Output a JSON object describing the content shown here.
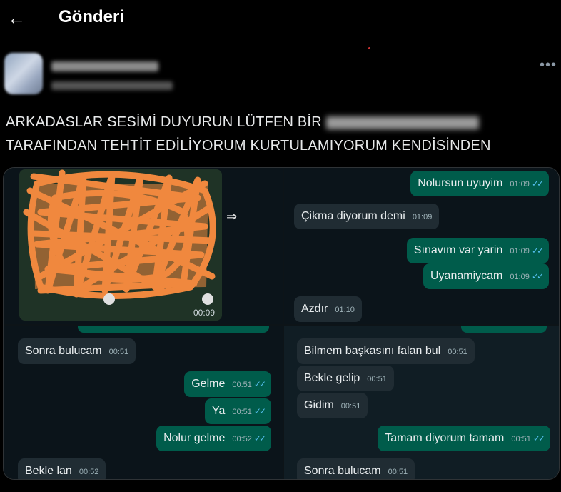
{
  "header": {
    "back_icon": "arrow-left-icon",
    "title": "Gönderi"
  },
  "post": {
    "more_icon": "more-dots-icon",
    "line1": "ARKADASLAR SESİMİ DUYURUN LÜTFEN BİR",
    "line2": "TARAFINDAN TEHTİT EDİLİYORUM KURTULAMIYORUM KENDİSİNDEN"
  },
  "panels": {
    "video": {
      "duration": "00:09",
      "forward_icon": "forward-icon"
    },
    "top_right": [
      {
        "text": "Nolursun uyuyim",
        "time": "01:09",
        "dir": "out"
      },
      {
        "text": "Çikma diyorum demi",
        "time": "01:09",
        "dir": "in"
      },
      {
        "text": "Sınavım var yarin",
        "time": "01:09",
        "dir": "out"
      },
      {
        "text": "Uyanamiycam",
        "time": "01:09",
        "dir": "out"
      },
      {
        "text": "Azdır",
        "time": "01:10",
        "dir": "in"
      }
    ],
    "bottom_left": [
      {
        "text": "Sonra bulucam",
        "time": "00:51",
        "dir": "in"
      },
      {
        "text": "Gelme",
        "time": "00:51",
        "dir": "out"
      },
      {
        "text": "Ya",
        "time": "00:51",
        "dir": "out"
      },
      {
        "text": "Nolur gelme",
        "time": "00:52",
        "dir": "out"
      },
      {
        "text": "Bekle lan",
        "time": "00:52",
        "dir": "in"
      }
    ],
    "bottom_right": [
      {
        "text": "Bilmem başkasını falan bul",
        "time": "00:51",
        "dir": "in"
      },
      {
        "text": "Bekle gelip",
        "time": "00:51",
        "dir": "in"
      },
      {
        "text": "Gidim",
        "time": "00:51",
        "dir": "in"
      },
      {
        "text": "Tamam diyorum tamam",
        "time": "00:51",
        "dir": "out"
      },
      {
        "text": "Sonra bulucam",
        "time": "00:51",
        "dir": "in"
      }
    ]
  },
  "colors": {
    "incoming": "#202c33",
    "outgoing": "#005c4b",
    "scribble": "#f0883e",
    "read_ticks": "#53bdeb"
  }
}
